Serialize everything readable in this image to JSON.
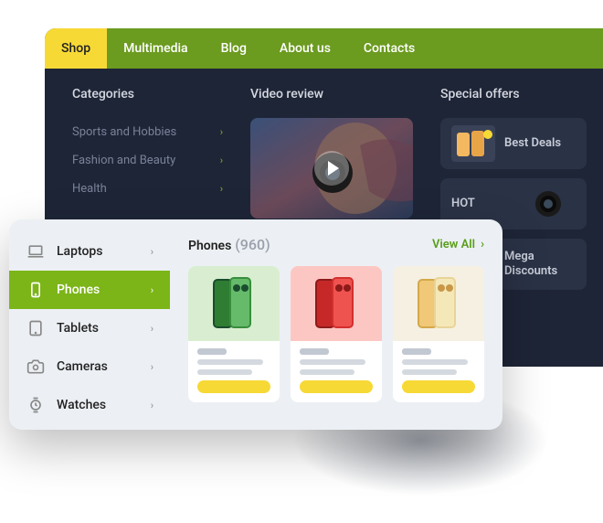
{
  "nav": {
    "items": [
      {
        "label": "Shop",
        "active": true
      },
      {
        "label": "Multimedia",
        "active": false
      },
      {
        "label": "Blog",
        "active": false
      },
      {
        "label": "About us",
        "active": false
      },
      {
        "label": "Contacts",
        "active": false
      }
    ]
  },
  "categories": {
    "heading": "Categories",
    "items": [
      {
        "label": "Sports and Hobbies"
      },
      {
        "label": "Fashion and Beauty"
      },
      {
        "label": "Health"
      }
    ]
  },
  "video": {
    "heading": "Video review"
  },
  "offers": {
    "heading": "Special offers",
    "items": [
      {
        "label": "Best Deals"
      },
      {
        "label": "HOT"
      },
      {
        "label": "Mega Discounts"
      }
    ]
  },
  "sidebar": {
    "items": [
      {
        "label": "Laptops",
        "icon": "laptop",
        "active": false
      },
      {
        "label": "Phones",
        "icon": "phone",
        "active": true
      },
      {
        "label": "Tablets",
        "icon": "tablet",
        "active": false
      },
      {
        "label": "Cameras",
        "icon": "camera",
        "active": false
      },
      {
        "label": "Watches",
        "icon": "watch",
        "active": false
      }
    ]
  },
  "main": {
    "title": "Phones",
    "count": "(960)",
    "view_all": "View All",
    "cards": [
      {
        "bg": "#d9eed1",
        "color1": "#2e7d32",
        "color2": "#66bb6a"
      },
      {
        "bg": "#fcc7c3",
        "color1": "#c62828",
        "color2": "#ef5350"
      },
      {
        "bg": "#f5f0e1",
        "color1": "#e0d088",
        "color2": "#f0e4a8"
      }
    ]
  }
}
